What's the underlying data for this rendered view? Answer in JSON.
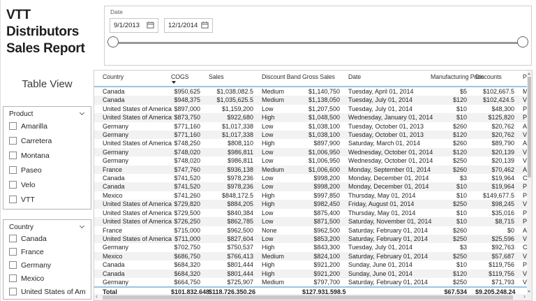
{
  "report": {
    "title_lines": [
      "VTT",
      "Distributors",
      "Sales Report"
    ],
    "view_label": "Table View"
  },
  "date_slicer": {
    "label": "Date",
    "start_date": "9/1/2013",
    "end_date": "12/1/2014"
  },
  "filters": {
    "product": {
      "title": "Product",
      "items": [
        "Amarilla",
        "Carretera",
        "Montana",
        "Paseo",
        "Velo",
        "VTT"
      ]
    },
    "country": {
      "title": "Country",
      "items": [
        "Canada",
        "France",
        "Germany",
        "Mexico",
        "United States of America"
      ]
    }
  },
  "table": {
    "columns": [
      {
        "key": "country",
        "label": "Country",
        "align": "left",
        "sorted": false
      },
      {
        "key": "cogs",
        "label": "COGS",
        "align": "right",
        "sorted": true
      },
      {
        "key": "sales",
        "label": "Sales",
        "align": "right",
        "sorted": false
      },
      {
        "key": "discount-band",
        "label": "Discount Band",
        "align": "left",
        "sorted": false
      },
      {
        "key": "gross-sales",
        "label": "Gross Sales",
        "align": "right",
        "sorted": false
      },
      {
        "key": "date",
        "label": "Date",
        "align": "left",
        "sorted": false
      },
      {
        "key": "manufacturing-price",
        "label": "Manufacturing Price",
        "align": "right",
        "sorted": false
      },
      {
        "key": "discounts",
        "label": "Discounts",
        "align": "right",
        "sorted": false
      },
      {
        "key": "product",
        "label": "Product",
        "align": "left",
        "sorted": false
      }
    ],
    "rows": [
      [
        "Canada",
        "$950,625",
        "$1,038,082.5",
        "Medium",
        "$1,140,750",
        "Tuesday, April 01, 2014",
        "$5",
        "$102,667.5",
        "Montana"
      ],
      [
        "Canada",
        "$948,375",
        "$1,035,625.5",
        "Medium",
        "$1,138,050",
        "Tuesday, July 01, 2014",
        "$120",
        "$102,424.5",
        "Velo"
      ],
      [
        "United States of America",
        "$897,000",
        "$1,159,200",
        "Low",
        "$1,207,500",
        "Tuesday, July 01, 2014",
        "$10",
        "$48,300",
        "Paseo"
      ],
      [
        "United States of America",
        "$873,750",
        "$922,680",
        "High",
        "$1,048,500",
        "Wednesday, January 01, 2014",
        "$10",
        "$125,820",
        "Paseo"
      ],
      [
        "Germany",
        "$771,160",
        "$1,017,338",
        "Low",
        "$1,038,100",
        "Tuesday, October 01, 2013",
        "$260",
        "$20,762",
        "Amarilla"
      ],
      [
        "Germany",
        "$771,160",
        "$1,017,338",
        "Low",
        "$1,038,100",
        "Tuesday, October 01, 2013",
        "$120",
        "$20,762",
        "Velo"
      ],
      [
        "United States of America",
        "$748,250",
        "$808,110",
        "High",
        "$897,900",
        "Saturday, March 01, 2014",
        "$260",
        "$89,790",
        "Amarilla"
      ],
      [
        "Germany",
        "$748,020",
        "$986,811",
        "Low",
        "$1,006,950",
        "Wednesday, October 01, 2014",
        "$120",
        "$20,139",
        "Velo"
      ],
      [
        "Germany",
        "$748,020",
        "$986,811",
        "Low",
        "$1,006,950",
        "Wednesday, October 01, 2014",
        "$250",
        "$20,139",
        "VTT"
      ],
      [
        "France",
        "$747,760",
        "$936,138",
        "Medium",
        "$1,006,600",
        "Monday, September 01, 2014",
        "$260",
        "$70,462",
        "Amarilla"
      ],
      [
        "Canada",
        "$741,520",
        "$978,236",
        "Low",
        "$998,200",
        "Monday, December 01, 2014",
        "$3",
        "$19,964",
        "Carretera"
      ],
      [
        "Canada",
        "$741,520",
        "$978,236",
        "Low",
        "$998,200",
        "Monday, December 01, 2014",
        "$10",
        "$19,964",
        "Paseo"
      ],
      [
        "Mexico",
        "$741,260",
        "$848,172.5",
        "High",
        "$997,850",
        "Thursday, May 01, 2014",
        "$10",
        "$149,677.5",
        "Paseo"
      ],
      [
        "United States of America",
        "$729,820",
        "$884,205",
        "High",
        "$982,450",
        "Friday, August 01, 2014",
        "$250",
        "$98,245",
        "VTT"
      ],
      [
        "United States of America",
        "$729,500",
        "$840,384",
        "Low",
        "$875,400",
        "Thursday, May 01, 2014",
        "$10",
        "$35,016",
        "Paseo"
      ],
      [
        "United States of America",
        "$726,250",
        "$862,785",
        "Low",
        "$871,500",
        "Saturday, November 01, 2014",
        "$10",
        "$8,715",
        "Paseo"
      ],
      [
        "France",
        "$715,000",
        "$962,500",
        "None",
        "$962,500",
        "Saturday, February 01, 2014",
        "$260",
        "$0",
        "Amarilla"
      ],
      [
        "United States of America",
        "$711,000",
        "$827,604",
        "Low",
        "$853,200",
        "Saturday, February 01, 2014",
        "$250",
        "$25,596",
        "VTT"
      ],
      [
        "Germany",
        "$702,750",
        "$750,537",
        "High",
        "$843,300",
        "Tuesday, July 01, 2014",
        "$3",
        "$92,763",
        "Carretera"
      ],
      [
        "Mexico",
        "$686,750",
        "$766,413",
        "Medium",
        "$824,100",
        "Saturday, February 01, 2014",
        "$250",
        "$57,687",
        "VTT"
      ],
      [
        "Canada",
        "$684,320",
        "$801,444",
        "High",
        "$921,200",
        "Sunday, June 01, 2014",
        "$10",
        "$119,756",
        "Paseo"
      ],
      [
        "Canada",
        "$684,320",
        "$801,444",
        "High",
        "$921,200",
        "Sunday, June 01, 2014",
        "$120",
        "$119,756",
        "Velo"
      ],
      [
        "Germany",
        "$664,750",
        "$725,907",
        "Medium",
        "$797,700",
        "Saturday, February 01, 2014",
        "$250",
        "$71,793",
        "VTT"
      ]
    ],
    "total": [
      "Total",
      "$101,832,648",
      "$118,726,350.26",
      "",
      "$127,931,598.5",
      "",
      "$67,534",
      "$9,205,248.24",
      ""
    ]
  },
  "icons": {
    "calendar-icon": "svg-calendar-grid",
    "chevron-down-icon": "css-chevron-down",
    "sort-descending-icon": "css-triangle-down",
    "scroll-left-icon": "‹",
    "scroll-right-icon": "›",
    "scroll-up-icon": "css-triangle-up",
    "scroll-down-icon": "css-triangle-down"
  },
  "colors": {
    "header_accent": "#9CC3E5",
    "row_alt": "#F2F2F2",
    "panel_border": "#CFCFCF",
    "text": "#252423"
  }
}
